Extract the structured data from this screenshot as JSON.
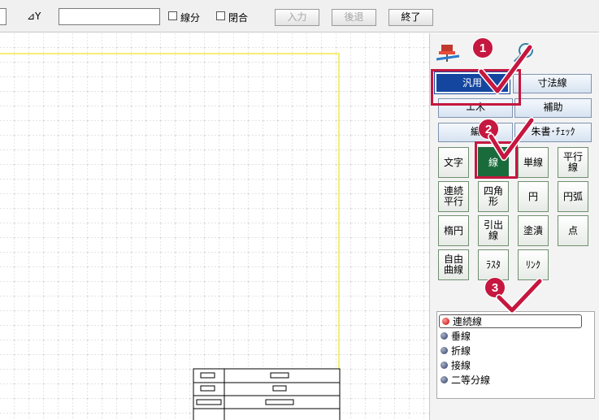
{
  "toolbar": {
    "dy_label": "⊿Y",
    "dy_value": "",
    "check_segment": "線分",
    "check_closed": "閉合",
    "btn_input": "入力",
    "btn_back": "後退",
    "btn_end": "終了"
  },
  "panel": {
    "category_tabs": [
      "汎用",
      "寸法線",
      "エ木",
      "補助",
      "編",
      "朱書･ﾁｪｯｸ"
    ],
    "selected_category": "汎用",
    "tools": [
      "文字",
      "線",
      "単線",
      "平行\n線",
      "連続\n平行",
      "四角\n形",
      "円",
      "円弧",
      "楕円",
      "引出\n線",
      "塗潰",
      "点",
      "自由\n曲線",
      "ﾗｽﾀ",
      "ﾘﾝｸ"
    ],
    "selected_tool": "線",
    "options": [
      "連続線",
      "垂線",
      "折線",
      "接線",
      "二等分線"
    ],
    "selected_option": "連続線"
  },
  "callouts": [
    "1",
    "2",
    "3"
  ],
  "colors": {
    "callout": "#c5173f",
    "selected_tab": "#1446a0",
    "selected_tool": "#1a6b3b",
    "sheet_border": "#f2e84a"
  },
  "icons": [
    "pin-icon",
    "magnifier-icon",
    "checkmark-icon"
  ]
}
